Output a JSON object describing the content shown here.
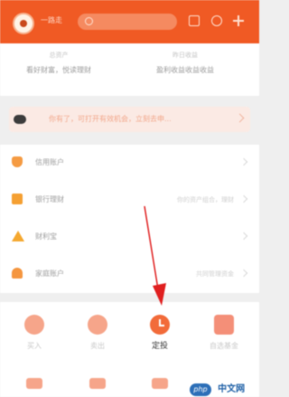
{
  "header": {
    "username": "一路走",
    "icons": [
      "avatar",
      "search-icon",
      "mail-icon",
      "message-icon",
      "plus-icon"
    ],
    "accent_color": "#f05a24"
  },
  "summary": {
    "left": {
      "label": "总资产",
      "value": "看好财富，悦读理财"
    },
    "right": {
      "label": "昨日收益",
      "value": "盈利收益收益收益"
    }
  },
  "notice": {
    "text": "你有了，可打开有效机会，立刻去申..."
  },
  "list": [
    {
      "icon": "shield-icon",
      "label": "信用账户",
      "value": ""
    },
    {
      "icon": "bag-icon",
      "label": "银行理财",
      "value": "你的资产组合，理财"
    },
    {
      "icon": "triangle-icon",
      "label": "财利宝",
      "value": ""
    },
    {
      "icon": "house-icon",
      "label": "家庭账户",
      "value": "共同管理资金"
    }
  ],
  "grid": [
    {
      "icon": "circle-icon",
      "label": "买入"
    },
    {
      "icon": "circle-icon",
      "label": "卖出"
    },
    {
      "icon": "clock-icon",
      "label": "定投"
    },
    {
      "icon": "grid-square-icon",
      "label": "自选基金"
    }
  ],
  "watermark": {
    "php": "php",
    "text": "中文网"
  }
}
